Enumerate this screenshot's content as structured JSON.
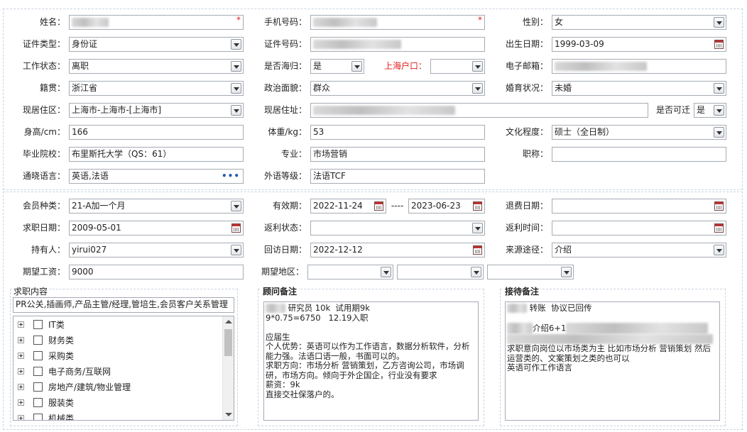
{
  "basic": {
    "name_label": "姓名：",
    "phone_label": "手机号码：",
    "gender_label": "性别：",
    "gender_value": "女",
    "id_type_label": "证件类型：",
    "id_type_value": "身份证",
    "id_no_label": "证件号码：",
    "birth_label": "出生日期：",
    "birth_value": "1999-03-09",
    "work_status_label": "工作状态：",
    "work_status_value": "离职",
    "overseas_label": "是否海归：",
    "overseas_value": "是",
    "hukou_label": "上海户口：",
    "hukou_value": "",
    "email_label": "电子邮箱：",
    "native_label": "籍贯：",
    "native_value": "浙江省",
    "political_label": "政治面貌：",
    "political_value": "群众",
    "marital_label": "婚育状况：",
    "marital_value": "未婚",
    "residence_label": "现居住区：",
    "residence_value": "上海市-上海市-[上海市]",
    "address_label": "现居住址：",
    "relocate_label": "是否可迁",
    "relocate_value": "是",
    "height_label": "身高/cm：",
    "height_value": "166",
    "weight_label": "体重/kg：",
    "weight_value": "53",
    "education_label": "文化程度：",
    "education_value": "硕士（全日制）",
    "school_label": "毕业院校：",
    "school_value": "布里斯托大学（QS：61）",
    "major_label": "专业：",
    "major_value": "市场营销",
    "title_label": "职称：",
    "title_value": "",
    "language_label": "通晓语言：",
    "language_value": "英语,法语",
    "language_more": "•••",
    "foreign_level_label": "外语等级：",
    "foreign_level_value": "法语TCF"
  },
  "member": {
    "type_label": "会员种类：",
    "type_value": "21-A加一个月",
    "validity_label": "有效期：",
    "validity_start": "2022-11-24",
    "validity_sep": "----",
    "validity_end": "2023-06-23",
    "refund_date_label": "退费日期：",
    "refund_date_value": "",
    "job_date_label": "求职日期：",
    "job_date_value": "2009-05-01",
    "rebate_status_label": "返利状态：",
    "rebate_status_value": "",
    "rebate_time_label": "返利时间：",
    "rebate_time_value": "",
    "holder_label": "持有人：",
    "holder_value": "yirui027",
    "revisit_label": "回访日期：",
    "revisit_value": "2022-12-12",
    "source_label": "来源途径：",
    "source_value": "介绍",
    "salary_label": "期望工资：",
    "salary_value": "9000",
    "region_label": "期望地区："
  },
  "job_content": {
    "title": "求职内容",
    "summary": "PR公关,插画师,产品主管/经理,管培生,会员客户关系管理（",
    "categories": [
      "IT类",
      "财务类",
      "采购类",
      "电子商务/互联网",
      "房地产/建筑/物业管理",
      "服装类",
      "机械类"
    ]
  },
  "consultant_notes": {
    "title": "顾问备注",
    "line1": " 研究员 10k  试用期9k",
    "body": "9*0.75=6750   12.19入职\n\n应届生\n个人优势：英语可以作为工作语言，数据分析软件，分析能力强。法语口语一般，书面可以的。\n求职方向：市场分析 营销策划，乙方咨询公司，市场调研，市场方向。倾向于外企国企，行业没有要求\n薪资：9k\n直接交社保落户的。"
  },
  "reception_notes": {
    "title": "接待备注",
    "line1": " 转账  协议已回传",
    "line2": "介绍6+1",
    "body": "求职意向岗位以市场类为主 比如市场分析 营销策划 然后运营类的、文案策划之类的也可以\n英语可作工作语言"
  },
  "icons": {
    "dropdown": "chevron-down-icon",
    "calendar": "calendar-icon",
    "required": "required-star-icon",
    "expand": "tree-expand-icon"
  },
  "colors": {
    "required": "#e21b1b",
    "border": "#a5acb5",
    "section_border": "#c9d3e0"
  }
}
